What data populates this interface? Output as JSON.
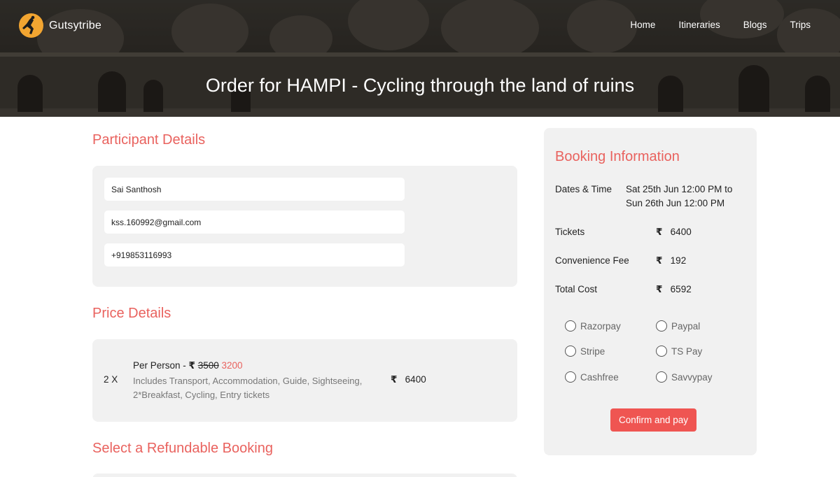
{
  "brand": {
    "name": "Gutsytribe"
  },
  "nav": [
    {
      "label": "Home"
    },
    {
      "label": "Itineraries"
    },
    {
      "label": "Blogs"
    },
    {
      "label": "Trips"
    }
  ],
  "hero": {
    "title": "Order for HAMPI - Cycling through the land of ruins"
  },
  "participant": {
    "heading": "Participant Details",
    "name": "Sai Santhosh",
    "email": "kss.160992@gmail.com",
    "phone": "+919853116993"
  },
  "price": {
    "heading": "Price Details",
    "quantity": "2 X",
    "per_person_label": "Per Person -",
    "currency": "₹",
    "old_price": "3500",
    "new_price": "3200",
    "description": "Includes Transport, Accommodation, Guide, Sightseeing, 2*Breakfast, Cycling, Entry tickets",
    "amount": "6400"
  },
  "refund": {
    "heading": "Select a Refundable Booking"
  },
  "booking": {
    "heading": "Booking Information",
    "dates_label": "Dates & Time",
    "dates_line1": "Sat 25th Jun 12:00 PM to",
    "dates_line2": "Sun 26th Jun 12:00 PM",
    "tickets_label": "Tickets",
    "tickets_value": "6400",
    "fee_label": "Convenience Fee",
    "fee_value": "192",
    "total_label": "Total Cost",
    "total_value": "6592",
    "currency": "₹"
  },
  "payment_options": [
    "Razorpay",
    "Paypal",
    "Stripe",
    "TS Pay",
    "Cashfree",
    "Savvypay"
  ],
  "confirm_button": "Confirm and pay",
  "colors": {
    "accent": "#e9625e",
    "button": "#ef5552",
    "panel": "#f1f1f1"
  }
}
